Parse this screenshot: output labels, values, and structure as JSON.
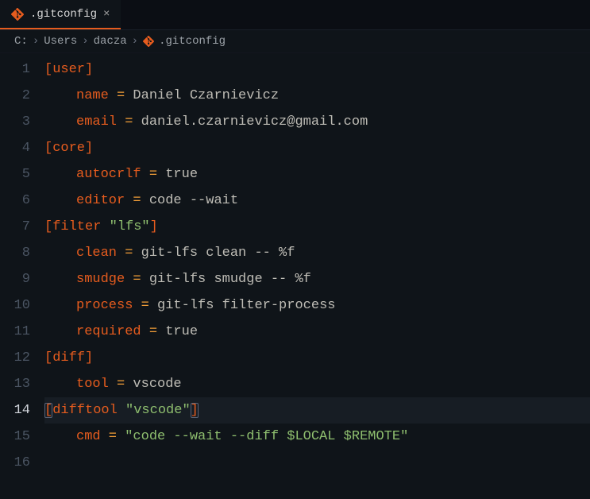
{
  "tab": {
    "filename": ".gitconfig",
    "close": "×"
  },
  "breadcrumb": {
    "drive": "C:",
    "user_dir": "Users",
    "username": "dacza",
    "filename": ".gitconfig",
    "chev": "›"
  },
  "lines": {
    "n1": "1",
    "n2": "2",
    "n3": "3",
    "n4": "4",
    "n5": "5",
    "n6": "6",
    "n7": "7",
    "n8": "8",
    "n9": "9",
    "n10": "10",
    "n11": "11",
    "n12": "12",
    "n13": "13",
    "n14": "14",
    "n15": "15",
    "n16": "16"
  },
  "code": {
    "l1": {
      "section": "[user]"
    },
    "l2": {
      "key": "name",
      "eq": " = ",
      "val": "Daniel Czarnievicz"
    },
    "l3": {
      "key": "email",
      "eq": " = ",
      "val": "daniel.czarnievicz@gmail.com"
    },
    "l4": {
      "section": "[core]"
    },
    "l5": {
      "key": "autocrlf",
      "eq": " = ",
      "val": "true"
    },
    "l6": {
      "key": "editor",
      "eq": " = ",
      "val": "code --wait"
    },
    "l7": {
      "open": "[",
      "name": "filter ",
      "q": "\"lfs\"",
      "close": "]"
    },
    "l8": {
      "key": "clean",
      "eq": " = ",
      "val": "git-lfs clean -- %f"
    },
    "l9": {
      "key": "smudge",
      "eq": " = ",
      "val": "git-lfs smudge -- %f"
    },
    "l10": {
      "key": "process",
      "eq": " = ",
      "val": "git-lfs filter-process"
    },
    "l11": {
      "key": "required",
      "eq": " = ",
      "val": "true"
    },
    "l12": {
      "section": "[diff]"
    },
    "l13": {
      "key": "tool",
      "eq": " = ",
      "val": "vscode"
    },
    "l14": {
      "open": "[",
      "name": "difftool ",
      "q": "\"vscode\"",
      "close": "]"
    },
    "l15": {
      "key": "cmd",
      "eq": " = ",
      "val": "\"code --wait --diff $LOCAL $REMOTE\""
    }
  }
}
